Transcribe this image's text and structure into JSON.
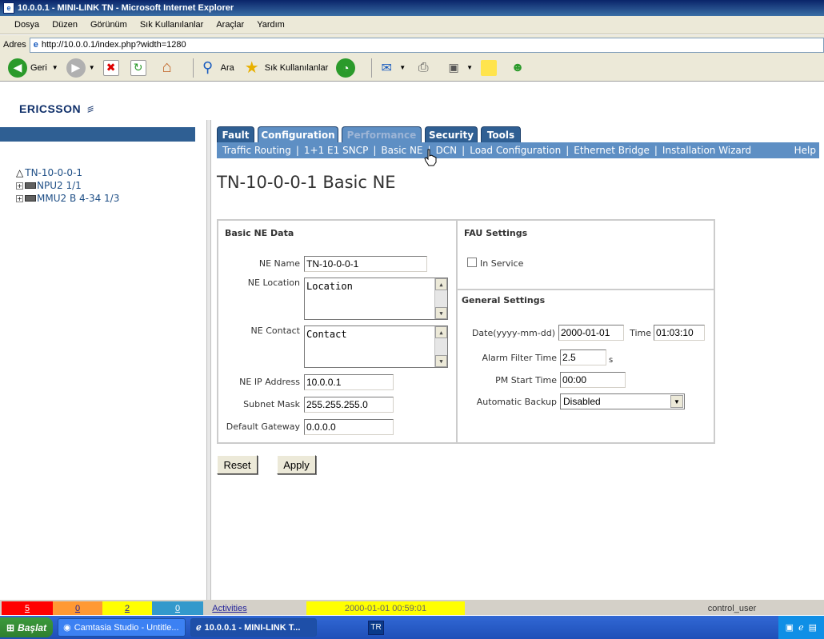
{
  "window": {
    "title": "10.0.0.1 - MINI-LINK TN - Microsoft Internet Explorer"
  },
  "menu": [
    "Dosya",
    "Düzen",
    "Görünüm",
    "Sık Kullanılanlar",
    "Araçlar",
    "Yardım"
  ],
  "address": {
    "label": "Adres",
    "url": "http://10.0.0.1/index.php?width=1280"
  },
  "toolbar": {
    "back": "Geri",
    "search": "Ara",
    "favorites": "Sık Kullanılanlar"
  },
  "brand": {
    "logo": "ERICSSON"
  },
  "tree": {
    "root": "TN-10-0-0-1",
    "children": [
      "NPU2 1/1",
      "MMU2 B 4-34 1/3"
    ]
  },
  "tabs": [
    {
      "label": "Fault"
    },
    {
      "label": "Configuration"
    },
    {
      "label": "Performance"
    },
    {
      "label": "Security"
    },
    {
      "label": "Tools"
    }
  ],
  "subnav": {
    "items": [
      "Traffic Routing",
      "1+1 E1 SNCP",
      "Basic NE",
      "DCN",
      "Load Configuration",
      "Ethernet Bridge",
      "Installation Wizard"
    ],
    "help": "Help"
  },
  "page": {
    "title": "TN-10-0-0-1 Basic NE"
  },
  "basic": {
    "heading": "Basic NE Data",
    "name_label": "NE Name",
    "name": "TN-10-0-0-1",
    "location_label": "NE Location",
    "location": "Location",
    "contact_label": "NE Contact",
    "contact": "Contact",
    "ip_label": "NE IP Address",
    "ip": "10.0.0.1",
    "mask_label": "Subnet Mask",
    "mask": "255.255.255.0",
    "gw_label": "Default Gateway",
    "gw": "0.0.0.0"
  },
  "fau": {
    "heading": "FAU Settings",
    "in_service": "In Service"
  },
  "general": {
    "heading": "General Settings",
    "date_label": "Date(yyyy-mm-dd)",
    "date": "2000-01-01",
    "time_label": "Time",
    "time": "01:03:10",
    "alarm_label": "Alarm Filter Time",
    "alarm": "2.5",
    "alarm_unit": "s",
    "pm_label": "PM Start Time",
    "pm": "00:00",
    "backup_label": "Automatic Backup",
    "backup": "Disabled"
  },
  "buttons": {
    "reset": "Reset",
    "apply": "Apply"
  },
  "status": {
    "critical": "5",
    "major": "0",
    "minor": "2",
    "warning": "0",
    "activities": "Activities",
    "datetime": "2000-01-01 00:59:01",
    "user": "control_user",
    "colors": {
      "critical": "#ff0000",
      "major": "#ff9933",
      "minor": "#ffff00",
      "warning": "#3399cc"
    }
  },
  "taskbar": {
    "start": "Başlat",
    "tasks": [
      "Camtasia Studio - Untitle...",
      "10.0.0.1 - MINI-LINK T..."
    ],
    "lang": "TR"
  }
}
